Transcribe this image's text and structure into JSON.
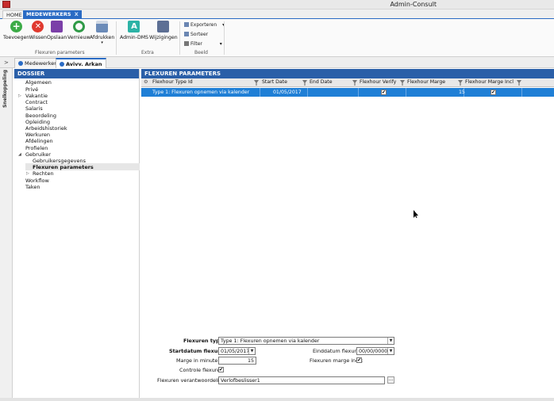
{
  "window": {
    "title": "Admin-Consult"
  },
  "tabs": [
    {
      "label": "HOME"
    },
    {
      "label": "MEDEWERKERS",
      "close": "X"
    }
  ],
  "ribbon": {
    "buttons": [
      {
        "label": "Toevoegen",
        "icon": "plus-circle-icon"
      },
      {
        "label": "Wissen",
        "icon": "delete-circle-icon"
      },
      {
        "label": "Opslaan",
        "icon": "save-icon"
      },
      {
        "label": "Vernieuw",
        "icon": "refresh-icon"
      },
      {
        "label": "Afdrukken",
        "icon": "print-icon"
      },
      {
        "label": "Admin-DMS",
        "icon": "dms-icon"
      },
      {
        "label": "Wijzigingen",
        "icon": "changes-icon"
      }
    ],
    "beeld_items": [
      {
        "label": "Exporteren"
      },
      {
        "label": "Sorteer"
      },
      {
        "label": "Filter"
      }
    ],
    "groups": {
      "flexuren_parameters": "Flexuren parameters",
      "extra": "Extra",
      "beeld": "Beeld"
    }
  },
  "doc_tabs": [
    {
      "label": "Medewerker"
    },
    {
      "label": "Avivv. Arkan"
    }
  ],
  "sidebar_strip": {
    "label": "Snelkoppeling"
  },
  "dossier": {
    "title": "DOSSIER",
    "items": [
      {
        "label": "Algemeen"
      },
      {
        "label": "Privé"
      },
      {
        "label": "Vakantie"
      },
      {
        "label": "Contract"
      },
      {
        "label": "Salaris"
      },
      {
        "label": "Beoordeling"
      },
      {
        "label": "Opleiding"
      },
      {
        "label": "Arbeidshistoriek"
      },
      {
        "label": "Werkuren"
      },
      {
        "label": "Afdelingen"
      },
      {
        "label": "Profielen"
      },
      {
        "label": "Gebruiker"
      },
      {
        "label": "Gebruikersgegevens"
      },
      {
        "label": "Flexuren parameters"
      },
      {
        "label": "Rechten"
      },
      {
        "label": "Workflow"
      },
      {
        "label": "Taken"
      }
    ]
  },
  "main": {
    "title": "FLEXUREN PARAMETERS",
    "columns": [
      "Flexhour Type Id",
      "Start Date",
      "End Date",
      "Flexhour Verify",
      "Flexhour Marge",
      "Flexhour Marge Incl"
    ],
    "rows": [
      {
        "type": "Type 1: Flexuren opnemen via kalender",
        "start": "01/05/2017",
        "end": "",
        "verify": "✔",
        "marge": "15",
        "marge_incl": "✔"
      }
    ]
  },
  "form": {
    "type_label": "Flexuren type:",
    "type_value": "Type 1: Flexuren opnemen via kalender",
    "start_label": "Startdatum flexuren",
    "start_value": "01/05/2017",
    "end_label": "Einddatum flexuren",
    "end_value": "00/00/0000",
    "marge_label": "Marge in minuten:",
    "marge_value": "15",
    "marge_incl_label": "Flexuren marge incl.:",
    "marge_incl_check": "✔",
    "controle_label": "Controle flexuren",
    "controle_check": "✔",
    "verantw_label": "Flexuren verantwoordelijke:",
    "verantw_value": "Verlofbeslisser1",
    "browse": "..."
  },
  "colors": {
    "accent": "#2a6bc4",
    "header": "#2a5fa8",
    "selection": "#1f7fd6"
  }
}
